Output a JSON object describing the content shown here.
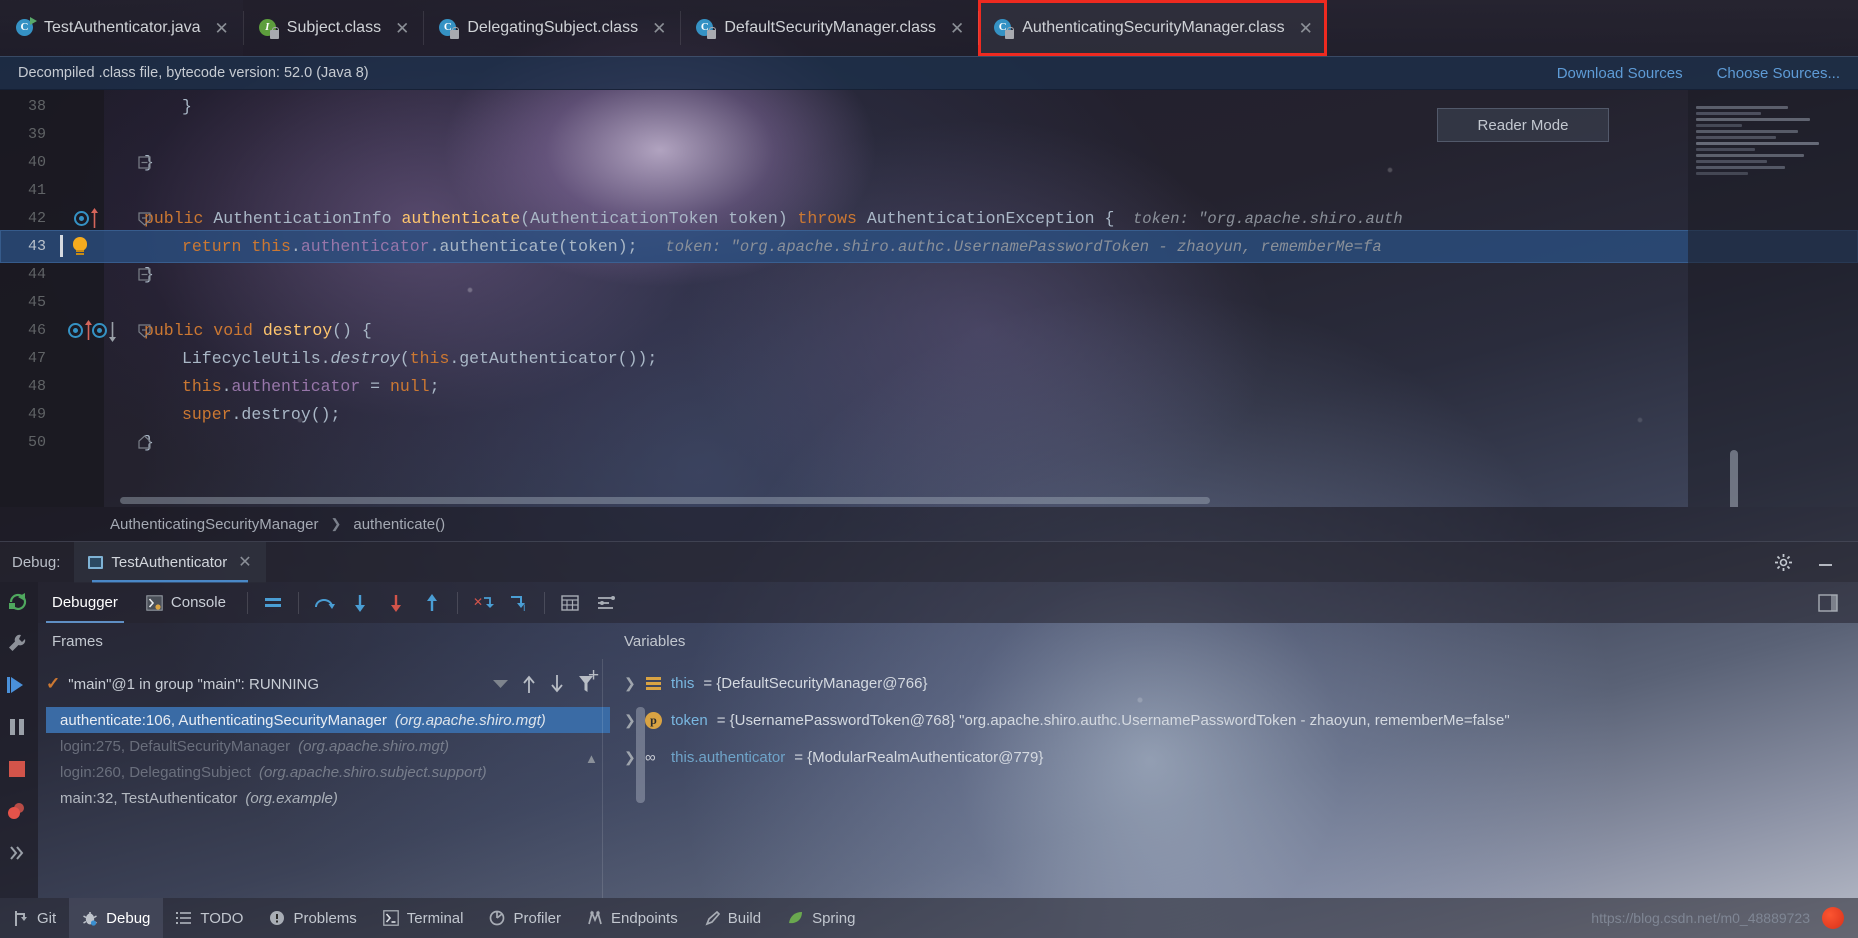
{
  "editor_tabs": [
    {
      "label": "TestAuthenticator.java",
      "icon": "java-class-icon",
      "active": false,
      "highlighted": false
    },
    {
      "label": "Subject.class",
      "icon": "interface-locked-icon",
      "active": false,
      "highlighted": false
    },
    {
      "label": "DelegatingSubject.class",
      "icon": "class-locked-icon",
      "active": false,
      "highlighted": false
    },
    {
      "label": "DefaultSecurityManager.class",
      "icon": "class-locked-icon",
      "active": false,
      "highlighted": false
    },
    {
      "label": "AuthenticatingSecurityManager.class",
      "icon": "class-locked-icon",
      "active": true,
      "highlighted": true
    }
  ],
  "notification": {
    "message": "Decompiled .class file, bytecode version: 52.0 (Java 8)",
    "download_sources": "Download Sources",
    "choose_sources": "Choose Sources..."
  },
  "reader_mode_label": "Reader Mode",
  "code_lines": [
    {
      "num": "38",
      "tokens": [
        {
          "t": "}",
          "c": "pl",
          "indent": 8
        }
      ]
    },
    {
      "num": "39",
      "tokens": []
    },
    {
      "num": "40",
      "tokens": [
        {
          "t": "}",
          "c": "pl",
          "indent": 4
        }
      ]
    },
    {
      "num": "41",
      "tokens": []
    },
    {
      "num": "42",
      "tokens": [
        {
          "t": "public ",
          "c": "kw",
          "indent": 4
        },
        {
          "t": "AuthenticationInfo ",
          "c": "cls2"
        },
        {
          "t": "authenticate",
          "c": "mth"
        },
        {
          "t": "(AuthenticationToken token) ",
          "c": "pl"
        },
        {
          "t": "throws ",
          "c": "kw"
        },
        {
          "t": "AuthenticationException {",
          "c": "pl"
        }
      ],
      "hint": "token: \"org.apache.shiro.auth"
    },
    {
      "num": "43",
      "highlighted": true,
      "tokens": [
        {
          "t": "return ",
          "c": "kw",
          "indent": 8
        },
        {
          "t": "this",
          "c": "kw"
        },
        {
          "t": ".",
          "c": "pl"
        },
        {
          "t": "authenticator",
          "c": "fld"
        },
        {
          "t": ".authenticate(token);",
          "c": "pl"
        }
      ],
      "hint": "token: \"org.apache.shiro.authc.UsernamePasswordToken - zhaoyun, rememberMe=fa"
    },
    {
      "num": "44",
      "tokens": [
        {
          "t": "}",
          "c": "pl",
          "indent": 4
        }
      ]
    },
    {
      "num": "45",
      "tokens": []
    },
    {
      "num": "46",
      "tokens": [
        {
          "t": "public void ",
          "c": "kw",
          "indent": 4
        },
        {
          "t": "destroy",
          "c": "mth"
        },
        {
          "t": "() {",
          "c": "pl"
        }
      ]
    },
    {
      "num": "47",
      "tokens": [
        {
          "t": "LifecycleUtils.",
          "c": "pl",
          "indent": 8
        },
        {
          "t": "destroy",
          "c": "mth-italic"
        },
        {
          "t": "(",
          "c": "pl"
        },
        {
          "t": "this",
          "c": "kw"
        },
        {
          "t": ".getAuthenticator());",
          "c": "pl"
        }
      ]
    },
    {
      "num": "48",
      "tokens": [
        {
          "t": "this",
          "c": "kw",
          "indent": 8
        },
        {
          "t": ".",
          "c": "pl"
        },
        {
          "t": "authenticator",
          "c": "fld"
        },
        {
          "t": " = ",
          "c": "pl"
        },
        {
          "t": "null",
          "c": "kw"
        },
        {
          "t": ";",
          "c": "pl"
        }
      ]
    },
    {
      "num": "49",
      "tokens": [
        {
          "t": "super",
          "c": "kw",
          "indent": 8
        },
        {
          "t": ".destroy();",
          "c": "pl"
        }
      ]
    },
    {
      "num": "50",
      "tokens": [
        {
          "t": "}",
          "c": "pl",
          "indent": 4
        }
      ]
    }
  ],
  "breadcrumb": {
    "class": "AuthenticatingSecurityManager",
    "method": "authenticate()"
  },
  "debug_window": {
    "label": "Debug:",
    "session_tab": "TestAuthenticator",
    "tabs": [
      {
        "label": "Debugger",
        "active": true
      },
      {
        "label": "Console",
        "active": false
      }
    ],
    "frames_header": "Frames",
    "variables_header": "Variables",
    "thread": "\"main\"@1 in group \"main\": RUNNING",
    "frames": [
      {
        "method": "authenticate:106, AuthenticatingSecurityManager",
        "package": "(org.apache.shiro.mgt)",
        "selected": true
      },
      {
        "method": "login:275, DefaultSecurityManager",
        "package": "(org.apache.shiro.mgt)",
        "selected": false
      },
      {
        "method": "login:260, DelegatingSubject",
        "package": "(org.apache.shiro.subject.support)",
        "selected": false
      },
      {
        "method": "main:32, TestAuthenticator",
        "package": "(org.example)",
        "selected": false
      }
    ],
    "variables": [
      {
        "badge": "fields",
        "name": "this",
        "value": "= {DefaultSecurityManager@766}"
      },
      {
        "badge": "param",
        "name": "token",
        "value": "= {UsernamePasswordToken@768} \"org.apache.shiro.authc.UsernamePasswordToken - zhaoyun, rememberMe=false\""
      },
      {
        "badge": "chain",
        "name": "this.authenticator",
        "value": "= {ModularRealmAuthenticator@779}"
      }
    ]
  },
  "status_bar": {
    "items": [
      {
        "label": "Git",
        "icon": "git-icon",
        "active": false
      },
      {
        "label": "Debug",
        "icon": "debug-bug-icon",
        "active": true
      },
      {
        "label": "TODO",
        "icon": "todo-list-icon",
        "active": false
      },
      {
        "label": "Problems",
        "icon": "problems-icon",
        "active": false
      },
      {
        "label": "Terminal",
        "icon": "terminal-icon",
        "active": false
      },
      {
        "label": "Profiler",
        "icon": "profiler-icon",
        "active": false
      },
      {
        "label": "Endpoints",
        "icon": "endpoints-icon",
        "active": false
      },
      {
        "label": "Build",
        "icon": "build-hammer-icon",
        "active": false
      },
      {
        "label": "Spring",
        "icon": "spring-leaf-icon",
        "active": false
      }
    ],
    "watermark": "https://blog.csdn.net/m0_48889723"
  },
  "colors": {
    "accent_blue": "#3592c4",
    "keyword_orange": "#cc7832",
    "method_yellow": "#ffc66d",
    "field_purple": "#9876aa",
    "highlight_red": "#ee2a20",
    "selection_blue": "#3a6ba5"
  }
}
